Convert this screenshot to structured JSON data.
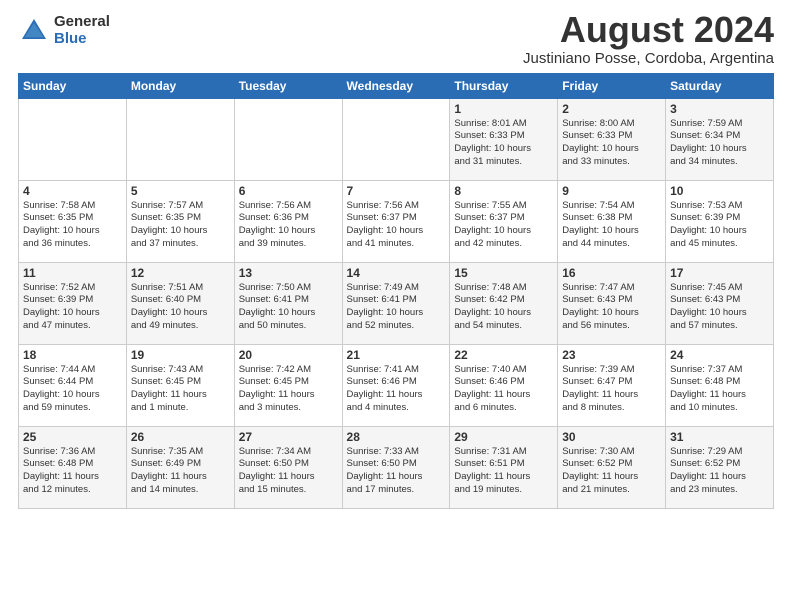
{
  "logo": {
    "general": "General",
    "blue": "Blue"
  },
  "title": "August 2024",
  "subtitle": "Justiniano Posse, Cordoba, Argentina",
  "days_of_week": [
    "Sunday",
    "Monday",
    "Tuesday",
    "Wednesday",
    "Thursday",
    "Friday",
    "Saturday"
  ],
  "weeks": [
    [
      {
        "day": "",
        "info": ""
      },
      {
        "day": "",
        "info": ""
      },
      {
        "day": "",
        "info": ""
      },
      {
        "day": "",
        "info": ""
      },
      {
        "day": "1",
        "info": "Sunrise: 8:01 AM\nSunset: 6:33 PM\nDaylight: 10 hours\nand 31 minutes."
      },
      {
        "day": "2",
        "info": "Sunrise: 8:00 AM\nSunset: 6:33 PM\nDaylight: 10 hours\nand 33 minutes."
      },
      {
        "day": "3",
        "info": "Sunrise: 7:59 AM\nSunset: 6:34 PM\nDaylight: 10 hours\nand 34 minutes."
      }
    ],
    [
      {
        "day": "4",
        "info": "Sunrise: 7:58 AM\nSunset: 6:35 PM\nDaylight: 10 hours\nand 36 minutes."
      },
      {
        "day": "5",
        "info": "Sunrise: 7:57 AM\nSunset: 6:35 PM\nDaylight: 10 hours\nand 37 minutes."
      },
      {
        "day": "6",
        "info": "Sunrise: 7:56 AM\nSunset: 6:36 PM\nDaylight: 10 hours\nand 39 minutes."
      },
      {
        "day": "7",
        "info": "Sunrise: 7:56 AM\nSunset: 6:37 PM\nDaylight: 10 hours\nand 41 minutes."
      },
      {
        "day": "8",
        "info": "Sunrise: 7:55 AM\nSunset: 6:37 PM\nDaylight: 10 hours\nand 42 minutes."
      },
      {
        "day": "9",
        "info": "Sunrise: 7:54 AM\nSunset: 6:38 PM\nDaylight: 10 hours\nand 44 minutes."
      },
      {
        "day": "10",
        "info": "Sunrise: 7:53 AM\nSunset: 6:39 PM\nDaylight: 10 hours\nand 45 minutes."
      }
    ],
    [
      {
        "day": "11",
        "info": "Sunrise: 7:52 AM\nSunset: 6:39 PM\nDaylight: 10 hours\nand 47 minutes."
      },
      {
        "day": "12",
        "info": "Sunrise: 7:51 AM\nSunset: 6:40 PM\nDaylight: 10 hours\nand 49 minutes."
      },
      {
        "day": "13",
        "info": "Sunrise: 7:50 AM\nSunset: 6:41 PM\nDaylight: 10 hours\nand 50 minutes."
      },
      {
        "day": "14",
        "info": "Sunrise: 7:49 AM\nSunset: 6:41 PM\nDaylight: 10 hours\nand 52 minutes."
      },
      {
        "day": "15",
        "info": "Sunrise: 7:48 AM\nSunset: 6:42 PM\nDaylight: 10 hours\nand 54 minutes."
      },
      {
        "day": "16",
        "info": "Sunrise: 7:47 AM\nSunset: 6:43 PM\nDaylight: 10 hours\nand 56 minutes."
      },
      {
        "day": "17",
        "info": "Sunrise: 7:45 AM\nSunset: 6:43 PM\nDaylight: 10 hours\nand 57 minutes."
      }
    ],
    [
      {
        "day": "18",
        "info": "Sunrise: 7:44 AM\nSunset: 6:44 PM\nDaylight: 10 hours\nand 59 minutes."
      },
      {
        "day": "19",
        "info": "Sunrise: 7:43 AM\nSunset: 6:45 PM\nDaylight: 11 hours\nand 1 minute."
      },
      {
        "day": "20",
        "info": "Sunrise: 7:42 AM\nSunset: 6:45 PM\nDaylight: 11 hours\nand 3 minutes."
      },
      {
        "day": "21",
        "info": "Sunrise: 7:41 AM\nSunset: 6:46 PM\nDaylight: 11 hours\nand 4 minutes."
      },
      {
        "day": "22",
        "info": "Sunrise: 7:40 AM\nSunset: 6:46 PM\nDaylight: 11 hours\nand 6 minutes."
      },
      {
        "day": "23",
        "info": "Sunrise: 7:39 AM\nSunset: 6:47 PM\nDaylight: 11 hours\nand 8 minutes."
      },
      {
        "day": "24",
        "info": "Sunrise: 7:37 AM\nSunset: 6:48 PM\nDaylight: 11 hours\nand 10 minutes."
      }
    ],
    [
      {
        "day": "25",
        "info": "Sunrise: 7:36 AM\nSunset: 6:48 PM\nDaylight: 11 hours\nand 12 minutes."
      },
      {
        "day": "26",
        "info": "Sunrise: 7:35 AM\nSunset: 6:49 PM\nDaylight: 11 hours\nand 14 minutes."
      },
      {
        "day": "27",
        "info": "Sunrise: 7:34 AM\nSunset: 6:50 PM\nDaylight: 11 hours\nand 15 minutes."
      },
      {
        "day": "28",
        "info": "Sunrise: 7:33 AM\nSunset: 6:50 PM\nDaylight: 11 hours\nand 17 minutes."
      },
      {
        "day": "29",
        "info": "Sunrise: 7:31 AM\nSunset: 6:51 PM\nDaylight: 11 hours\nand 19 minutes."
      },
      {
        "day": "30",
        "info": "Sunrise: 7:30 AM\nSunset: 6:52 PM\nDaylight: 11 hours\nand 21 minutes."
      },
      {
        "day": "31",
        "info": "Sunrise: 7:29 AM\nSunset: 6:52 PM\nDaylight: 11 hours\nand 23 minutes."
      }
    ]
  ]
}
